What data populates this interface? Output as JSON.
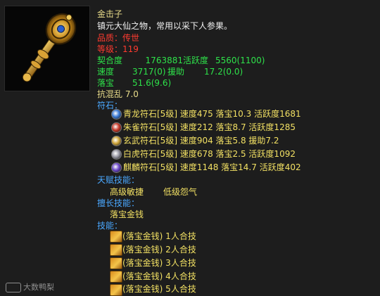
{
  "item": {
    "name": "金击子",
    "desc": "镇元大仙之物，常用以采下人参果。",
    "quality_label": "品质：",
    "quality_value": "传世",
    "level_label": "等级：",
    "level_value": "119",
    "fit_label": "契合度",
    "fit_value": "1763881",
    "activity_label": "活跃度",
    "activity_value": "5560(1100)",
    "speed_label": "速度",
    "speed_value": "3717(0)",
    "assist_label": "援助",
    "assist_value": "17.2(0.0)",
    "loot_label": "落宝",
    "loot_value": "51.6(9.6)",
    "resist_label": "抗混乱",
    "resist_value": "7.0"
  },
  "runes": {
    "title": "符石：",
    "items": [
      {
        "text": "青龙符石[5级] 速度475 落宝10.3 活跃度1681",
        "icon": "azure-dragon-rune-icon",
        "color": "#3b7bd6"
      },
      {
        "text": "朱雀符石[5级] 速度212 落宝8.7 活跃度1285",
        "icon": "vermilion-bird-rune-icon",
        "color": "#c73a2a"
      },
      {
        "text": "玄武符石[5级] 速度904 落宝5.8 援助7.2",
        "icon": "black-tortoise-rune-icon",
        "color": "#cfa53a"
      },
      {
        "text": "白虎符石[5级] 速度678 落宝2.5 活跃度1092",
        "icon": "white-tiger-rune-icon",
        "color": "#9a9aa6"
      },
      {
        "text": "麒麟符石[5级] 速度1148 落宝14.7 活跃度402",
        "icon": "qilin-rune-icon",
        "color": "#6c48c9"
      }
    ]
  },
  "talent": {
    "title": "天赋技能：",
    "values": [
      "高级敏捷",
      "低级怨气"
    ]
  },
  "specialty": {
    "title": "擅长技能：",
    "value": "落宝金钱"
  },
  "skills": {
    "title": "技能：",
    "items": [
      "(落宝金钱) 1人合技",
      "(落宝金钱) 2人合技",
      "(落宝金钱) 3人合技",
      "(落宝金钱) 4人合技",
      "(落宝金钱) 5人合技"
    ]
  },
  "watermark": "大数鸭梨"
}
